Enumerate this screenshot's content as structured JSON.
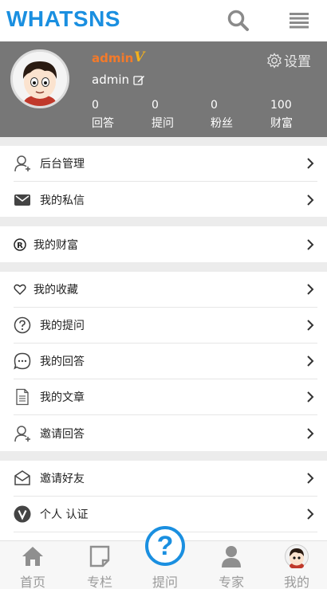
{
  "app": {
    "logo": "WHATSNS"
  },
  "header_icons": {
    "search": "search-icon",
    "menu": "menu-icon"
  },
  "profile": {
    "username_accent": "admin",
    "vip_badge": "V",
    "username": "admin",
    "settings_label": "设置",
    "stats": [
      {
        "value": "0",
        "label": "回答"
      },
      {
        "value": "0",
        "label": "提问"
      },
      {
        "value": "0",
        "label": "粉丝"
      },
      {
        "value": "100",
        "label": "财富"
      }
    ]
  },
  "menu": {
    "admin": "后台管理",
    "messages": "我的私信",
    "wealth": "我的财富",
    "favorites": "我的收藏",
    "questions": "我的提问",
    "answers": "我的回答",
    "articles": "我的文章",
    "invite_answer": "邀请回答",
    "invite_friends": "邀请好友",
    "verify": "个人 认证"
  },
  "bottom_nav": [
    {
      "label": "首页",
      "icon": "home-icon"
    },
    {
      "label": "专栏",
      "icon": "column-icon"
    },
    {
      "label": "提问",
      "icon": "question-icon"
    },
    {
      "label": "专家",
      "icon": "expert-icon"
    },
    {
      "label": "我的",
      "icon": "avatar"
    }
  ],
  "colors": {
    "brand": "#1a8fe0",
    "accent_orange": "#f47a2a",
    "vip_gold": "#f5b21b",
    "header_gray": "#777777"
  }
}
